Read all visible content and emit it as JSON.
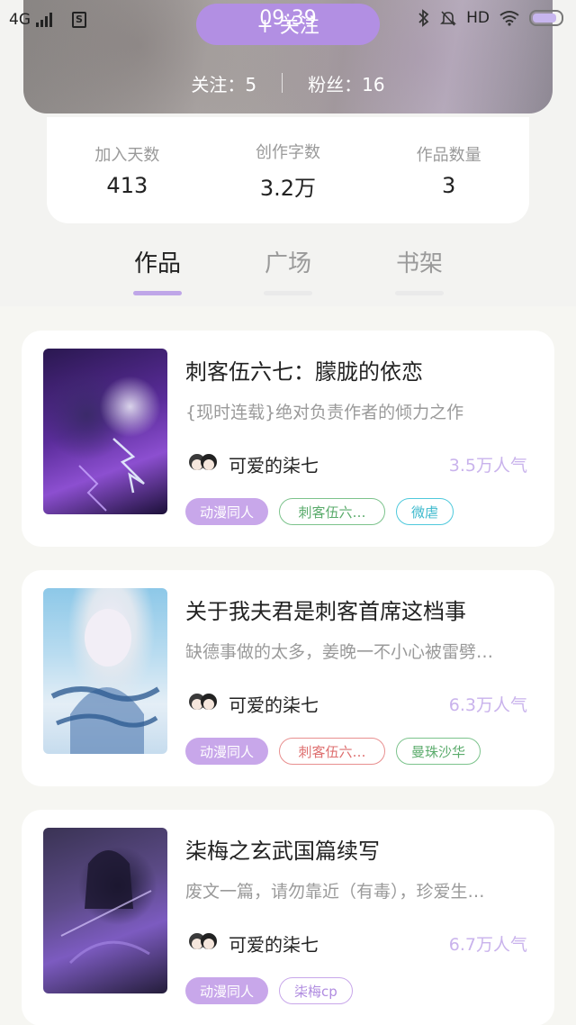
{
  "status_bar": {
    "network": "4G",
    "sim_label": "S",
    "time": "09:39",
    "hd_label": "HD"
  },
  "profile": {
    "follow_button": "+ 关注",
    "following_label": "关注：5",
    "followers_label": "粉丝：16"
  },
  "stats": [
    {
      "label": "加入天数",
      "value": "413"
    },
    {
      "label": "创作字数",
      "value": "3.2万"
    },
    {
      "label": "作品数量",
      "value": "3"
    }
  ],
  "tabs": [
    {
      "label": "作品",
      "active": true
    },
    {
      "label": "广场",
      "active": false
    },
    {
      "label": "书架",
      "active": false
    }
  ],
  "books": [
    {
      "title": "刺客伍六七：朦胧的依恋",
      "description": "{现时连载}绝对负责作者的倾力之作",
      "author": "可爱的柒七",
      "popularity": "3.5万人气",
      "tags": [
        "动漫同人",
        "刺客伍六…",
        "微虐"
      ]
    },
    {
      "title": "关于我夫君是刺客首席这档事",
      "description": "缺德事做的太多，姜晚一不小心被雷劈…",
      "author": "可爱的柒七",
      "popularity": "6.3万人气",
      "tags": [
        "动漫同人",
        "刺客伍六…",
        "曼珠沙华"
      ]
    },
    {
      "title": "柒梅之玄武国篇续写",
      "description": "废文一篇，请勿靠近（有毒），珍爱生…",
      "author": "可爱的柒七",
      "popularity": "6.7万人气",
      "tags": [
        "动漫同人",
        "柒梅cp"
      ]
    }
  ],
  "colors": {
    "accent": "#b28fe3",
    "popularity": "#c9b3ec",
    "tag_fill": "#c8a7ea"
  }
}
